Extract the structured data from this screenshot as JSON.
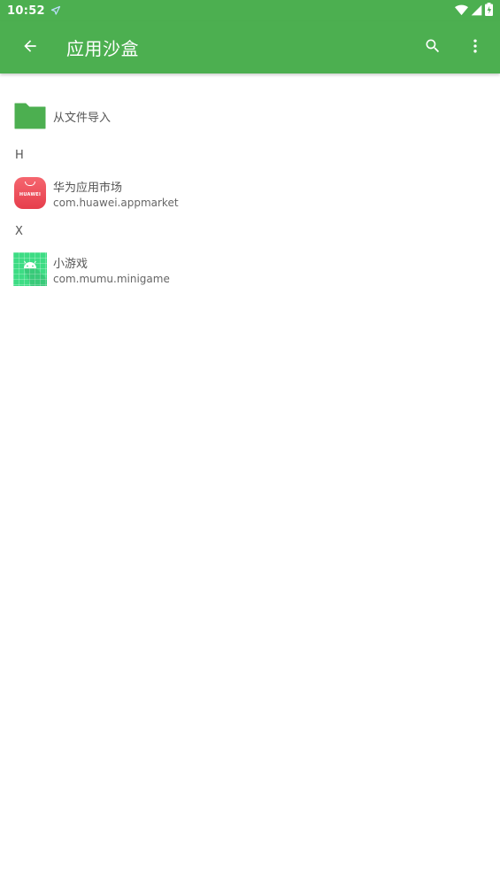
{
  "status_bar": {
    "time": "10:52",
    "icons": [
      "navigation-icon",
      "wifi-icon",
      "cell-signal-icon",
      "battery-charging-icon"
    ]
  },
  "toolbar": {
    "title": "应用沙盒",
    "back_icon": "arrow-back-icon",
    "search_icon": "search-icon",
    "more_icon": "more-vert-icon",
    "color": "#4caf50"
  },
  "import_item": {
    "label": "从文件导入",
    "icon": "folder-icon"
  },
  "sections": [
    {
      "header": "H",
      "apps": [
        {
          "name": "华为应用市场",
          "package": "com.huawei.appmarket",
          "icon": "huawei-appgallery-icon",
          "icon_text": "HUAWEI"
        }
      ]
    },
    {
      "header": "X",
      "apps": [
        {
          "name": "小游戏",
          "package": "com.mumu.minigame",
          "icon": "android-icon"
        }
      ]
    }
  ]
}
